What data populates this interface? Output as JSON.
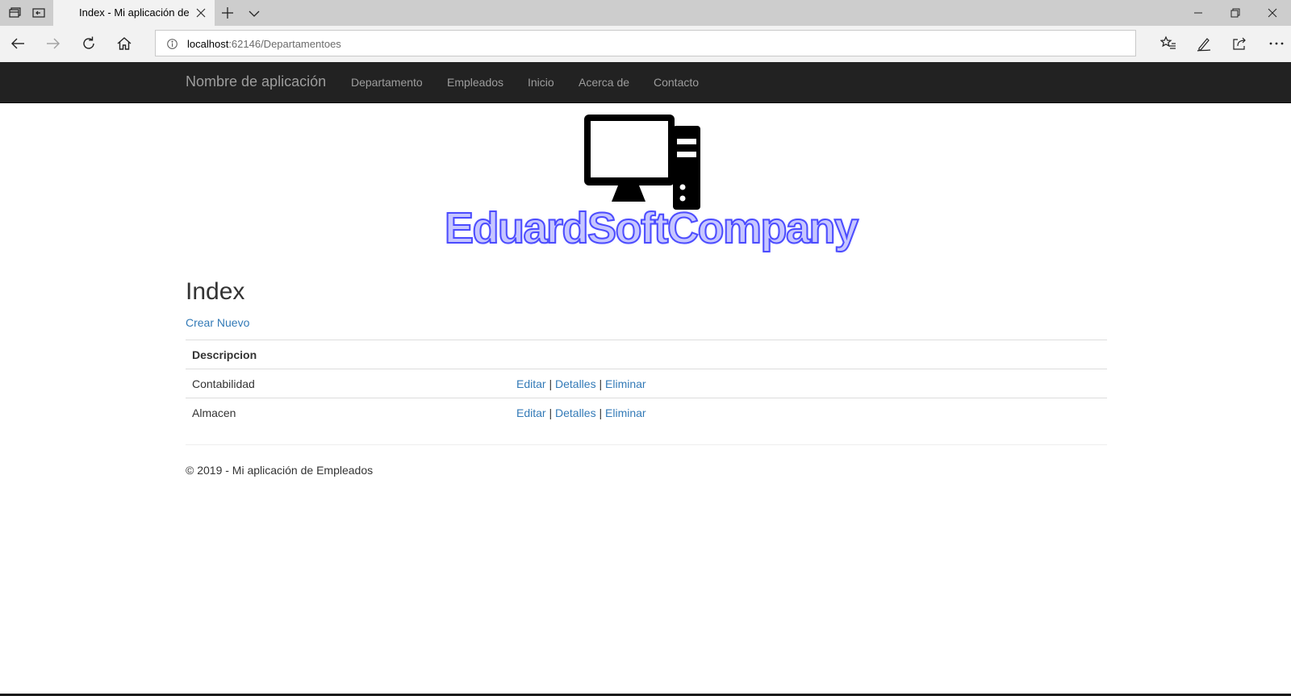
{
  "browser": {
    "tab": {
      "title": "Index - Mi aplicación de"
    },
    "address": {
      "host": "localhost",
      "rest": ":62146/Departamentoes"
    }
  },
  "navbar": {
    "brand": "Nombre de aplicación",
    "links": [
      "Departamento",
      "Empleados",
      "Inicio",
      "Acerca de",
      "Contacto"
    ]
  },
  "logo": {
    "text": "EduardSoftCompany"
  },
  "main": {
    "title": "Index",
    "create_link": "Crear Nuevo",
    "table": {
      "header": "Descripcion",
      "rows": [
        {
          "descripcion": "Contabilidad",
          "actions": [
            "Editar",
            "Detalles",
            "Eliminar"
          ]
        },
        {
          "descripcion": "Almacen",
          "actions": [
            "Editar",
            "Detalles",
            "Eliminar"
          ]
        }
      ],
      "separator": "|"
    }
  },
  "footer": {
    "text": "© 2019 - Mi aplicación de Empleados"
  },
  "colors": {
    "navbar_bg": "#222222",
    "navbar_text": "#9d9d9d",
    "link": "#337ab7",
    "logo_fill": "#c6c6ff",
    "logo_stroke": "#4b4bff"
  },
  "icons": {
    "tab_actions": [
      "tabs-aside-icon",
      "restore-tabs-icon"
    ],
    "tab": [
      "close-icon",
      "plus-icon",
      "chevron-down-icon"
    ],
    "window": [
      "minimize-icon",
      "restore-icon",
      "close-icon"
    ],
    "navigation": [
      "back-arrow-icon",
      "forward-arrow-icon",
      "refresh-icon",
      "home-icon",
      "info-icon"
    ],
    "toolbar": [
      "favorites-icon",
      "pen-icon",
      "share-icon",
      "more-icon"
    ],
    "logo": "desktop-computer-icon"
  }
}
